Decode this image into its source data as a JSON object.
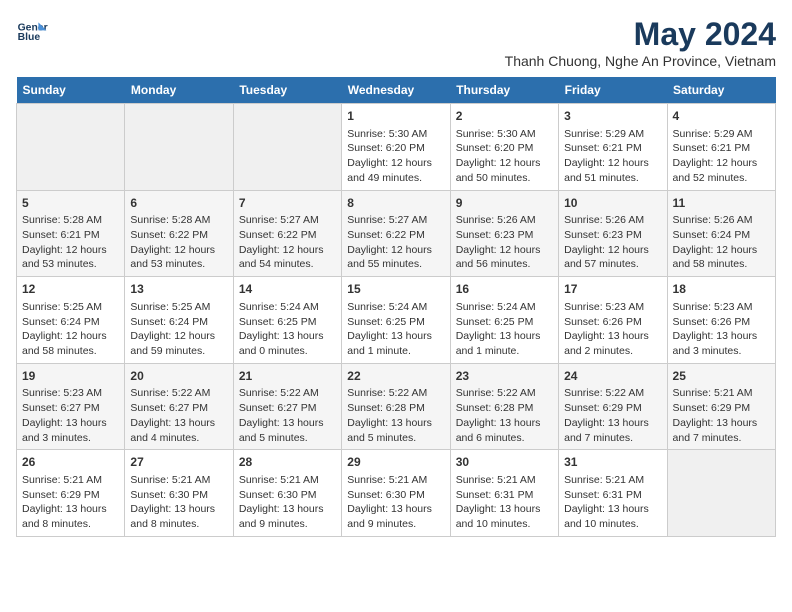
{
  "header": {
    "logo_line1": "General",
    "logo_line2": "Blue",
    "title": "May 2024",
    "subtitle": "Thanh Chuong, Nghe An Province, Vietnam"
  },
  "weekdays": [
    "Sunday",
    "Monday",
    "Tuesday",
    "Wednesday",
    "Thursday",
    "Friday",
    "Saturday"
  ],
  "weeks": [
    [
      {
        "day": "",
        "info": ""
      },
      {
        "day": "",
        "info": ""
      },
      {
        "day": "",
        "info": ""
      },
      {
        "day": "1",
        "info": "Sunrise: 5:30 AM\nSunset: 6:20 PM\nDaylight: 12 hours\nand 49 minutes."
      },
      {
        "day": "2",
        "info": "Sunrise: 5:30 AM\nSunset: 6:20 PM\nDaylight: 12 hours\nand 50 minutes."
      },
      {
        "day": "3",
        "info": "Sunrise: 5:29 AM\nSunset: 6:21 PM\nDaylight: 12 hours\nand 51 minutes."
      },
      {
        "day": "4",
        "info": "Sunrise: 5:29 AM\nSunset: 6:21 PM\nDaylight: 12 hours\nand 52 minutes."
      }
    ],
    [
      {
        "day": "5",
        "info": "Sunrise: 5:28 AM\nSunset: 6:21 PM\nDaylight: 12 hours\nand 53 minutes."
      },
      {
        "day": "6",
        "info": "Sunrise: 5:28 AM\nSunset: 6:22 PM\nDaylight: 12 hours\nand 53 minutes."
      },
      {
        "day": "7",
        "info": "Sunrise: 5:27 AM\nSunset: 6:22 PM\nDaylight: 12 hours\nand 54 minutes."
      },
      {
        "day": "8",
        "info": "Sunrise: 5:27 AM\nSunset: 6:22 PM\nDaylight: 12 hours\nand 55 minutes."
      },
      {
        "day": "9",
        "info": "Sunrise: 5:26 AM\nSunset: 6:23 PM\nDaylight: 12 hours\nand 56 minutes."
      },
      {
        "day": "10",
        "info": "Sunrise: 5:26 AM\nSunset: 6:23 PM\nDaylight: 12 hours\nand 57 minutes."
      },
      {
        "day": "11",
        "info": "Sunrise: 5:26 AM\nSunset: 6:24 PM\nDaylight: 12 hours\nand 58 minutes."
      }
    ],
    [
      {
        "day": "12",
        "info": "Sunrise: 5:25 AM\nSunset: 6:24 PM\nDaylight: 12 hours\nand 58 minutes."
      },
      {
        "day": "13",
        "info": "Sunrise: 5:25 AM\nSunset: 6:24 PM\nDaylight: 12 hours\nand 59 minutes."
      },
      {
        "day": "14",
        "info": "Sunrise: 5:24 AM\nSunset: 6:25 PM\nDaylight: 13 hours\nand 0 minutes."
      },
      {
        "day": "15",
        "info": "Sunrise: 5:24 AM\nSunset: 6:25 PM\nDaylight: 13 hours\nand 1 minute."
      },
      {
        "day": "16",
        "info": "Sunrise: 5:24 AM\nSunset: 6:25 PM\nDaylight: 13 hours\nand 1 minute."
      },
      {
        "day": "17",
        "info": "Sunrise: 5:23 AM\nSunset: 6:26 PM\nDaylight: 13 hours\nand 2 minutes."
      },
      {
        "day": "18",
        "info": "Sunrise: 5:23 AM\nSunset: 6:26 PM\nDaylight: 13 hours\nand 3 minutes."
      }
    ],
    [
      {
        "day": "19",
        "info": "Sunrise: 5:23 AM\nSunset: 6:27 PM\nDaylight: 13 hours\nand 3 minutes."
      },
      {
        "day": "20",
        "info": "Sunrise: 5:22 AM\nSunset: 6:27 PM\nDaylight: 13 hours\nand 4 minutes."
      },
      {
        "day": "21",
        "info": "Sunrise: 5:22 AM\nSunset: 6:27 PM\nDaylight: 13 hours\nand 5 minutes."
      },
      {
        "day": "22",
        "info": "Sunrise: 5:22 AM\nSunset: 6:28 PM\nDaylight: 13 hours\nand 5 minutes."
      },
      {
        "day": "23",
        "info": "Sunrise: 5:22 AM\nSunset: 6:28 PM\nDaylight: 13 hours\nand 6 minutes."
      },
      {
        "day": "24",
        "info": "Sunrise: 5:22 AM\nSunset: 6:29 PM\nDaylight: 13 hours\nand 7 minutes."
      },
      {
        "day": "25",
        "info": "Sunrise: 5:21 AM\nSunset: 6:29 PM\nDaylight: 13 hours\nand 7 minutes."
      }
    ],
    [
      {
        "day": "26",
        "info": "Sunrise: 5:21 AM\nSunset: 6:29 PM\nDaylight: 13 hours\nand 8 minutes."
      },
      {
        "day": "27",
        "info": "Sunrise: 5:21 AM\nSunset: 6:30 PM\nDaylight: 13 hours\nand 8 minutes."
      },
      {
        "day": "28",
        "info": "Sunrise: 5:21 AM\nSunset: 6:30 PM\nDaylight: 13 hours\nand 9 minutes."
      },
      {
        "day": "29",
        "info": "Sunrise: 5:21 AM\nSunset: 6:30 PM\nDaylight: 13 hours\nand 9 minutes."
      },
      {
        "day": "30",
        "info": "Sunrise: 5:21 AM\nSunset: 6:31 PM\nDaylight: 13 hours\nand 10 minutes."
      },
      {
        "day": "31",
        "info": "Sunrise: 5:21 AM\nSunset: 6:31 PM\nDaylight: 13 hours\nand 10 minutes."
      },
      {
        "day": "",
        "info": ""
      }
    ]
  ]
}
